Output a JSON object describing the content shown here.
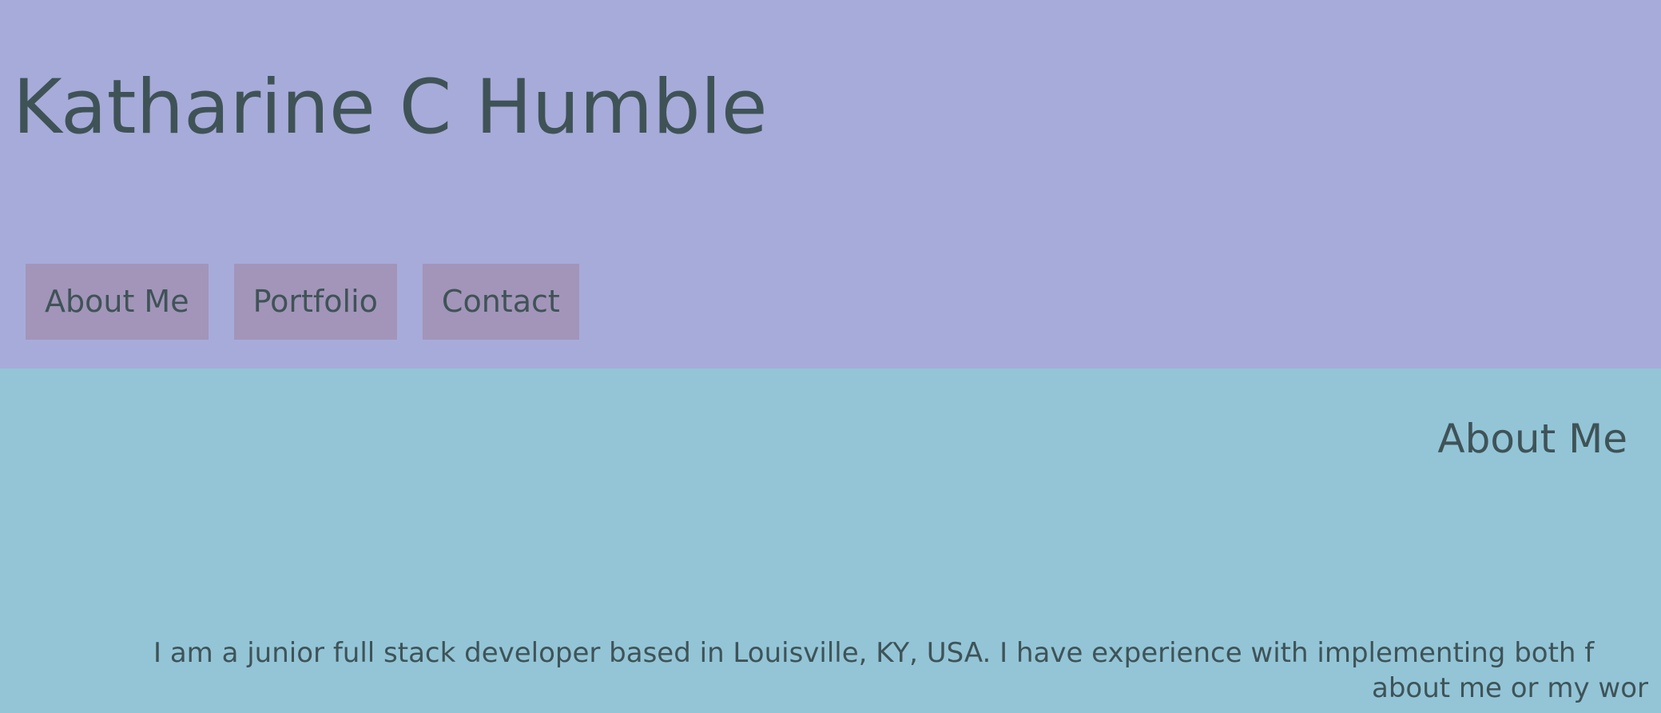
{
  "header": {
    "title": "Katharine C Humble",
    "nav": [
      {
        "label": "About Me"
      },
      {
        "label": "Portfolio"
      },
      {
        "label": "Contact"
      }
    ]
  },
  "about": {
    "heading": "About Me",
    "text_line1": "I am a junior full stack developer based in Louisville, KY, USA. I have experience with implementing both f",
    "text_line2": "about me or my wor"
  },
  "colors": {
    "header_bg": "#a7abd9",
    "nav_button_bg": "#a295b9",
    "about_bg": "#93c5d7",
    "text": "#3f5357"
  }
}
